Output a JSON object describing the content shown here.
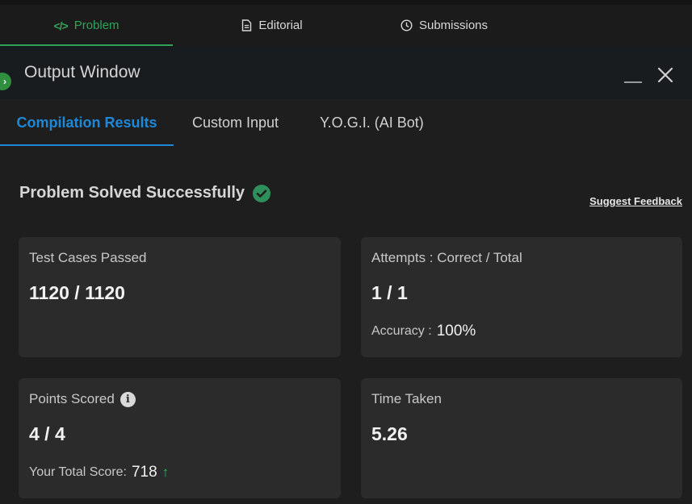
{
  "top_tabs": [
    {
      "label": "Problem",
      "icon": "code-icon",
      "active": true
    },
    {
      "label": "Editorial",
      "icon": "document-icon",
      "active": false
    },
    {
      "label": "Submissions",
      "icon": "clock-icon",
      "active": false
    }
  ],
  "output_window": {
    "title": "Output Window",
    "badge_icon": "chevron-right-icon"
  },
  "result_tabs": [
    {
      "label": "Compilation Results",
      "active": true
    },
    {
      "label": "Custom Input",
      "active": false
    },
    {
      "label": "Y.O.G.I. (AI Bot)",
      "active": false
    }
  ],
  "status": {
    "text": "Problem Solved Successfully",
    "icon": "check-circle-icon",
    "feedback_link": "Suggest Feedback"
  },
  "cards": {
    "test_cases": {
      "label": "Test Cases Passed",
      "value": "1120 / 1120"
    },
    "attempts": {
      "label": "Attempts : Correct / Total",
      "value": "1 / 1",
      "sub_label": "Accuracy :",
      "sub_value": "100%"
    },
    "points": {
      "label": "Points Scored",
      "value": "4 / 4",
      "sub_label": "Your Total Score:",
      "sub_value": "718"
    },
    "time": {
      "label": "Time Taken",
      "value": "5.26"
    }
  },
  "colors": {
    "accent_green": "#2fa35a",
    "accent_blue": "#1e88d8",
    "card_bg": "#2b2b2b",
    "page_bg": "#1e1e1e"
  }
}
